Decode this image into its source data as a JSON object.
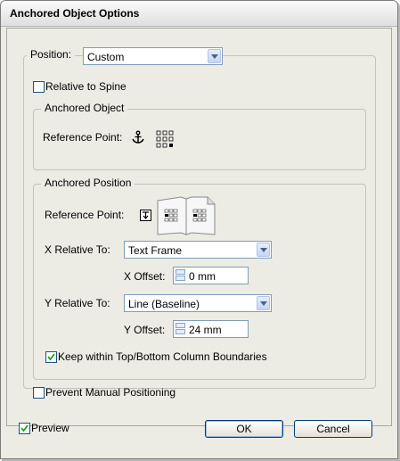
{
  "window": {
    "title": "Anchored Object Options"
  },
  "position": {
    "label": "Position:",
    "value": "Custom"
  },
  "relative_to_spine": {
    "label": "Relative to Spine",
    "checked": false
  },
  "anchored_object": {
    "title": "Anchored Object",
    "reference_point_label": "Reference Point:"
  },
  "anchored_position": {
    "title": "Anchored Position",
    "reference_point_label": "Reference Point:",
    "x_relative_label": "X Relative To:",
    "x_relative_value": "Text Frame",
    "x_offset_label": "X Offset:",
    "x_offset_value": "0 mm",
    "y_relative_label": "Y Relative To:",
    "y_relative_value": "Line (Baseline)",
    "y_offset_label": "Y Offset:",
    "y_offset_value": "24 mm",
    "keep_within_label": "Keep within Top/Bottom Column Boundaries",
    "keep_within_checked": true
  },
  "prevent_manual": {
    "label": "Prevent Manual Positioning",
    "checked": false
  },
  "preview": {
    "label": "Preview",
    "checked": true
  },
  "buttons": {
    "ok": "OK",
    "cancel": "Cancel"
  }
}
